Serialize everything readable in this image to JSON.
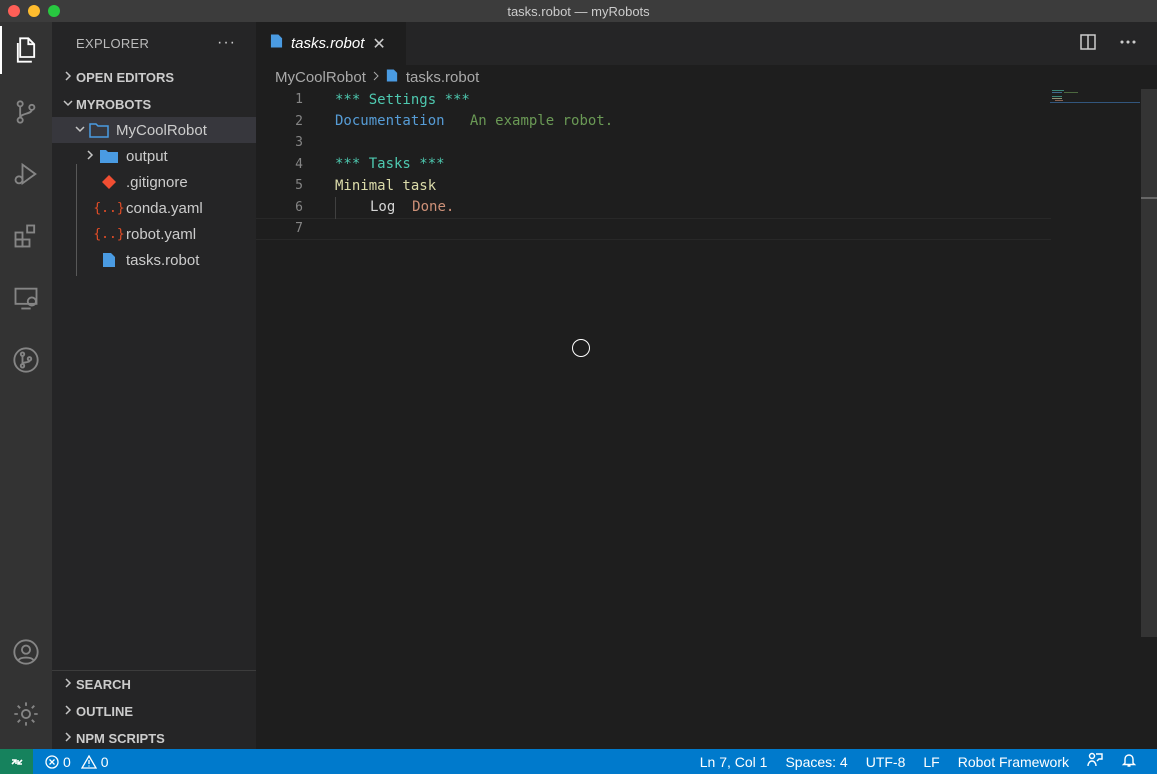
{
  "window": {
    "title": "tasks.robot — myRobots"
  },
  "activity_bar": {
    "icons": [
      "files-icon",
      "source-control-icon",
      "run-debug-icon",
      "extensions-icon",
      "remote-explorer-icon",
      "git-graph-icon",
      "account-icon",
      "settings-gear-icon"
    ]
  },
  "sidebar": {
    "title": "EXPLORER",
    "more": "···",
    "open_editors": "OPEN EDITORS",
    "workspace": "MYROBOTS",
    "tree": {
      "root": "MyCoolRobot",
      "items": [
        "output",
        ".gitignore",
        "conda.yaml",
        "robot.yaml",
        "tasks.robot"
      ]
    },
    "search": "SEARCH",
    "outline": "OUTLINE",
    "npm_scripts": "NPM SCRIPTS"
  },
  "tab": {
    "label": "tasks.robot",
    "close": "✕"
  },
  "breadcrumb": {
    "folder": "MyCoolRobot",
    "file": "tasks.robot"
  },
  "editor": {
    "line_numbers": [
      "1",
      "2",
      "3",
      "4",
      "5",
      "6",
      "7"
    ],
    "l1": "*** Settings ***",
    "l2_key": "Documentation",
    "l2_val": "An example robot.",
    "l4": "*** Tasks ***",
    "l5": "Minimal task",
    "l6_kw": "Log",
    "l6_arg": "Done."
  },
  "statusbar": {
    "errors": "0",
    "warnings": "0",
    "position": "Ln 7, Col 1",
    "spaces": "Spaces: 4",
    "encoding": "UTF-8",
    "eol": "LF",
    "language": "Robot Framework"
  },
  "colors": {
    "accent": "#007acc",
    "remote": "#16825d",
    "folder": "#4a9be2",
    "yaml_icon": "#e44d26",
    "git_icon": "#f14e32"
  }
}
